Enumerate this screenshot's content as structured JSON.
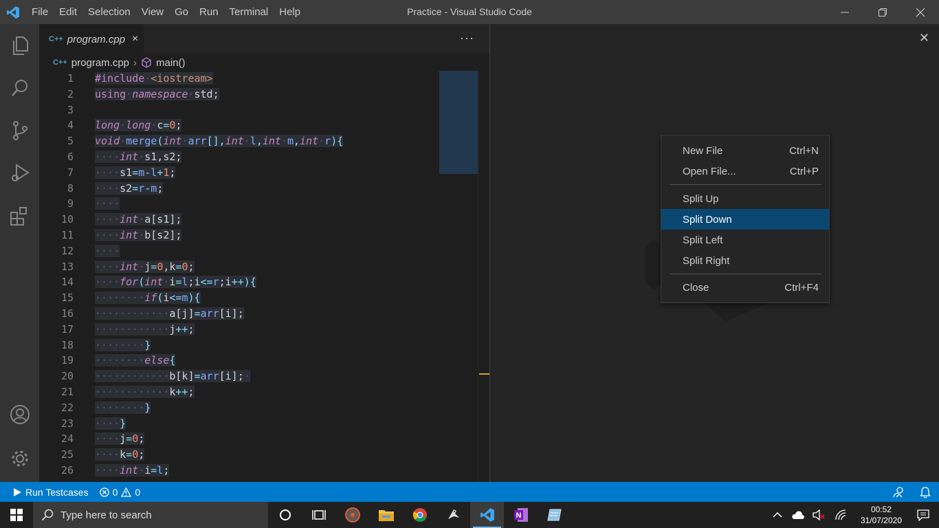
{
  "window": {
    "title": "Practice - Visual Studio Code"
  },
  "menu": [
    "File",
    "Edit",
    "Selection",
    "View",
    "Go",
    "Run",
    "Terminal",
    "Help"
  ],
  "tab": {
    "filename": "program.cpp",
    "icon_text": "C++"
  },
  "breadcrumb": {
    "file": "program.cpp",
    "symbol": "main()"
  },
  "code_lines": [
    {
      "n": "1"
    },
    {
      "n": "2"
    },
    {
      "n": "3"
    },
    {
      "n": "4"
    },
    {
      "n": "5"
    },
    {
      "n": "6"
    },
    {
      "n": "7"
    },
    {
      "n": "8"
    },
    {
      "n": "9"
    },
    {
      "n": "10"
    },
    {
      "n": "11"
    },
    {
      "n": "12"
    },
    {
      "n": "13"
    },
    {
      "n": "14"
    },
    {
      "n": "15"
    },
    {
      "n": "16"
    },
    {
      "n": "17"
    },
    {
      "n": "18"
    },
    {
      "n": "19"
    },
    {
      "n": "20"
    },
    {
      "n": "21"
    },
    {
      "n": "22"
    },
    {
      "n": "23"
    },
    {
      "n": "24"
    },
    {
      "n": "25"
    },
    {
      "n": "26"
    }
  ],
  "context_menu": {
    "new_file": "New File",
    "new_file_key": "Ctrl+N",
    "open_file": "Open File...",
    "open_file_key": "Ctrl+P",
    "split_up": "Split Up",
    "split_down": "Split Down",
    "split_left": "Split Left",
    "split_right": "Split Right",
    "close": "Close",
    "close_key": "Ctrl+F4"
  },
  "statusbar": {
    "run_testcases": "Run Testcases",
    "errors": "0",
    "warnings": "0"
  },
  "taskbar": {
    "search_placeholder": "Type here to search",
    "time": "00:52",
    "date": "31/07/2020"
  },
  "colors": {
    "accent": "#007acc",
    "menu_highlight": "#094771",
    "keyword": "#c586c0",
    "number": "#f78c6c"
  }
}
